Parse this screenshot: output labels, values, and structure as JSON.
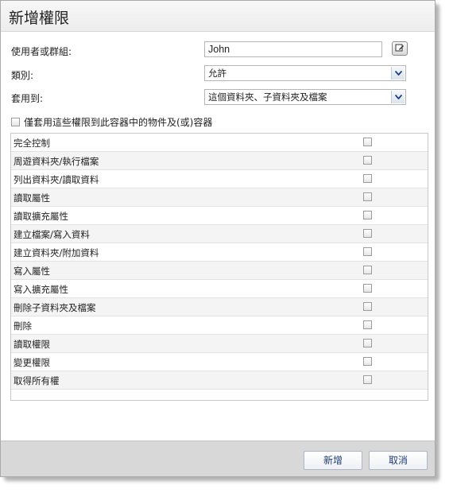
{
  "dialog": {
    "title": "新增權限"
  },
  "form": {
    "user_label": "使用者或群組:",
    "user_value": "John",
    "type_label": "類別:",
    "type_value": "允許",
    "apply_label": "套用到:",
    "apply_value": "這個資料夾、子資料夾及檔案",
    "only_apply_label": "僅套用這些權限到此容器中的物件及(或)容器",
    "only_apply_checked": false
  },
  "permissions": [
    {
      "label": "完全控制",
      "checked": false
    },
    {
      "label": "周遊資料夾/執行檔案",
      "checked": false
    },
    {
      "label": "列出資料夾/讀取資料",
      "checked": false
    },
    {
      "label": "讀取屬性",
      "checked": false
    },
    {
      "label": "讀取擴充屬性",
      "checked": false
    },
    {
      "label": "建立檔案/寫入資料",
      "checked": false
    },
    {
      "label": "建立資料夾/附加資料",
      "checked": false
    },
    {
      "label": "寫入屬性",
      "checked": false
    },
    {
      "label": "寫入擴充屬性",
      "checked": false
    },
    {
      "label": "刪除子資料夾及檔案",
      "checked": false
    },
    {
      "label": "刪除",
      "checked": false
    },
    {
      "label": "讀取權限",
      "checked": false
    },
    {
      "label": "變更權限",
      "checked": false
    },
    {
      "label": "取得所有權",
      "checked": false
    }
  ],
  "buttons": {
    "add": "新增",
    "cancel": "取消"
  },
  "icons": {
    "edit": "edit-icon",
    "dropdown": "chevron-down-icon"
  }
}
